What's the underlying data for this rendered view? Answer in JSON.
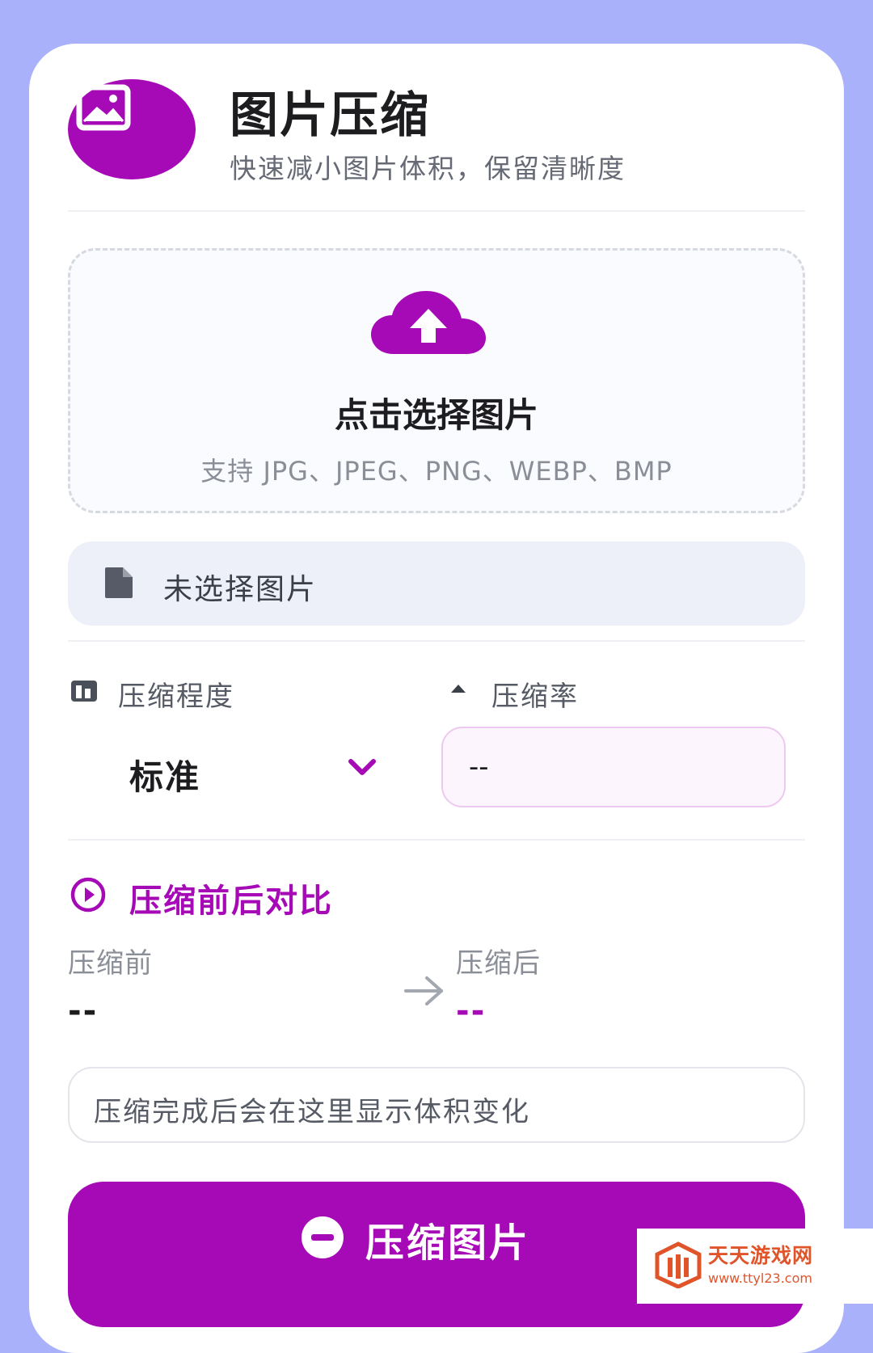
{
  "header": {
    "title": "图片压缩",
    "subtitle": "快速减小图片体积，保留清晰度",
    "logo_icon": "image-icon"
  },
  "upload": {
    "icon": "cloud-upload-icon",
    "title": "点击选择图片",
    "formats": "支持 JPG、JPEG、PNG、WEBP、BMP"
  },
  "file_status": {
    "icon": "file-icon",
    "text": "未选择图片"
  },
  "settings": {
    "level_label": "压缩程度",
    "level_icon": "sliders-icon",
    "level_value": "标准",
    "rate_label": "压缩率",
    "rate_icon": "caret-up-icon",
    "rate_value": "--"
  },
  "comparison": {
    "title": "压缩前后对比",
    "icon": "play-circle-icon",
    "before_label": "压缩前",
    "before_value": "--",
    "after_label": "压缩后",
    "after_value": "--",
    "note": "压缩完成后会在这里显示体积变化"
  },
  "action": {
    "label": "压缩图片",
    "icon": "minus-circle-icon"
  },
  "watermark": {
    "name": "天天游戏网",
    "url": "www.ttyl23.com"
  },
  "colors": {
    "accent": "#a60ab6",
    "background": "#a9b1fb",
    "card": "#ffffff",
    "input_bg": "#eef0f9"
  }
}
